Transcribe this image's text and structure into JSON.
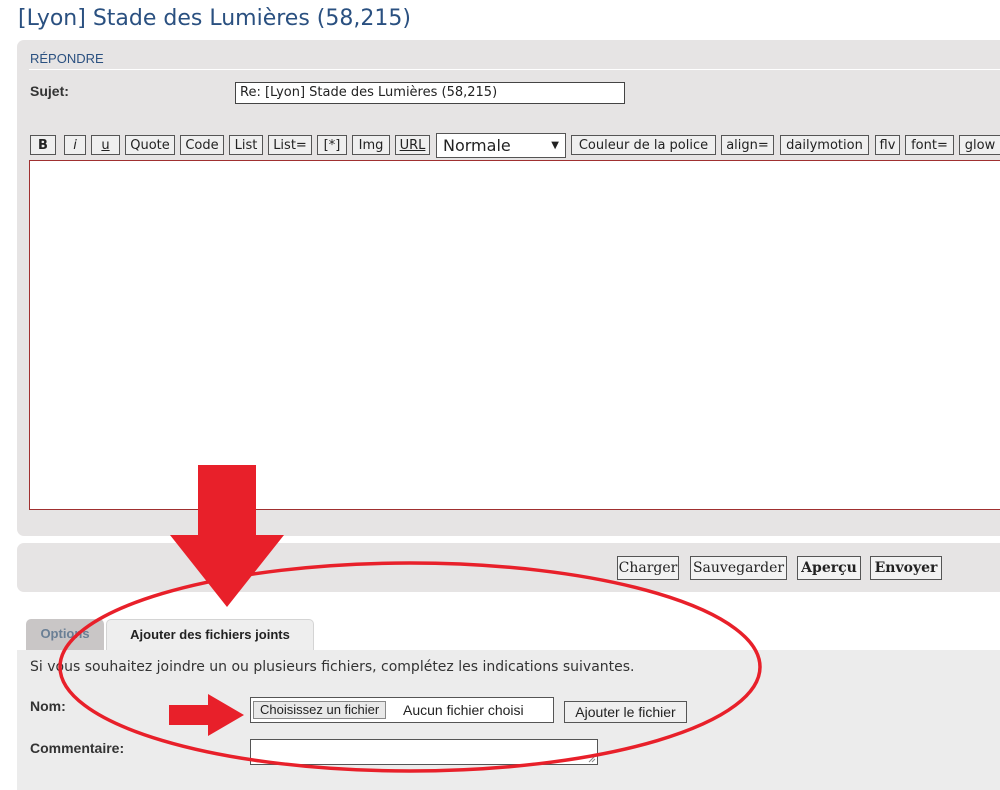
{
  "page": {
    "title": "[Lyon] Stade des Lumières (58,215)"
  },
  "reply": {
    "section_label": "RÉPONDRE",
    "subject_label": "Sujet:",
    "subject_value": "Re: [Lyon] Stade des Lumières (58,215)"
  },
  "toolbar": {
    "buttons": [
      "B",
      "i",
      "u",
      "Quote",
      "Code",
      "List",
      "List=",
      "[*]",
      "Img",
      "URL",
      "Couleur de la police",
      "align=",
      "dailymotion",
      "flv",
      "font=",
      "glow"
    ],
    "size_select": "Normale"
  },
  "actions": {
    "load": "Charger",
    "save": "Sauvegarder",
    "preview": "Aperçu",
    "send": "Envoyer"
  },
  "tabs": {
    "options": "Options",
    "attach": "Ajouter des fichiers joints"
  },
  "attachments": {
    "info": "Si vous souhaitez joindre un ou plusieurs fichiers, complétez les indications suivantes.",
    "name_label": "Nom:",
    "choose_button": "Choisissez un fichier",
    "no_file": "Aucun fichier choisi",
    "add_button": "Ajouter le fichier",
    "comment_label": "Commentaire:"
  },
  "colors": {
    "annotation": "#e8202a",
    "title": "#2a5080"
  },
  "icons": {
    "dropdown": "triangle-down-icon",
    "arrow_down": "arrow-down-icon",
    "arrow_right": "arrow-right-icon",
    "circle": "ellipse-annotation"
  }
}
